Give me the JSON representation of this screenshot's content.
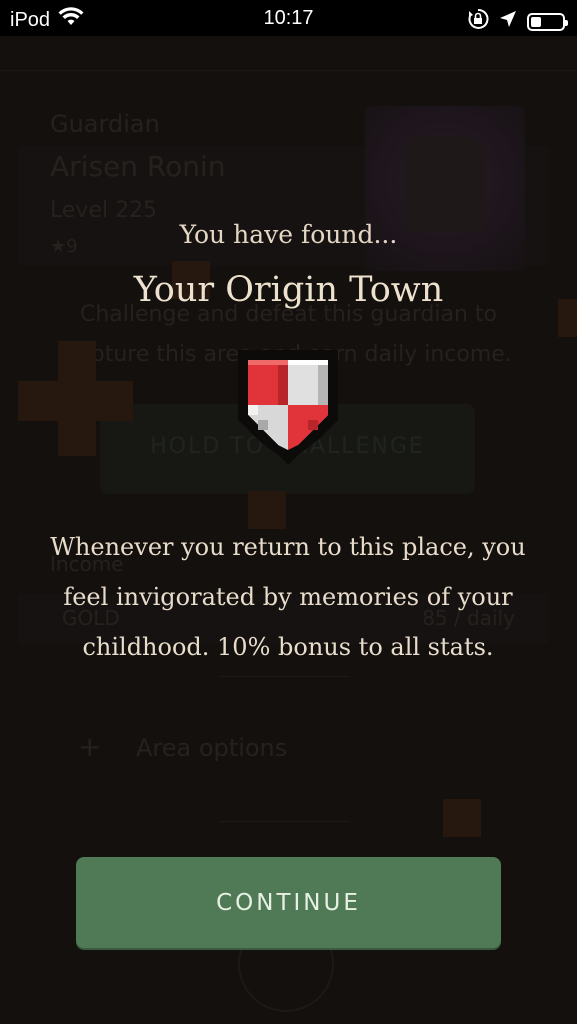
{
  "status_bar": {
    "carrier": "iPod",
    "time": "10:17",
    "icons": [
      "wifi-icon",
      "orientation-lock-icon",
      "location-arrow-icon",
      "battery-icon"
    ]
  },
  "background": {
    "guardian_label": "Guardian",
    "guardian_name": "Arisen Ronin",
    "level": "Level 225",
    "stars": "★9",
    "challenge_text_1": "Challenge and defeat this guardian to",
    "challenge_text_2": "capture this area and earn daily income.",
    "hold_button": "HOLD TO CHALLENGE",
    "income_label": "Income",
    "gold_label": "GOLD",
    "gold_value": "85 / daily",
    "area_options": "Area options"
  },
  "modal": {
    "found_text": "You have found...",
    "place_name": "Your Origin Town",
    "description_line1": "Whenever you return to this place, you",
    "description_line2": "feel invigorated by memories of your",
    "description_line3": "childhood. 10% bonus to all stats.",
    "continue_label": "CONTINUE",
    "shield_colors": {
      "red": "#e0343a",
      "white": "#e0e0e0",
      "outline": "#0d0b0a"
    }
  },
  "colors": {
    "continue_bg": "#4f7a55",
    "background": "#171412"
  }
}
